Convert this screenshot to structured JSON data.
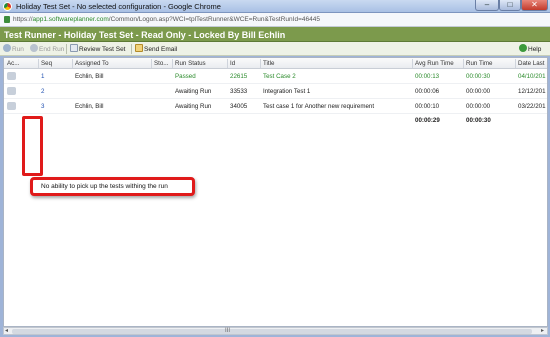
{
  "window": {
    "title": "Holiday Test Set - No selected configuration - Google Chrome",
    "min": "–",
    "max": "□",
    "close": "✕"
  },
  "address": {
    "scheme": "https://",
    "host": "app1.softwareplanner.com",
    "path": "/Common/Logon.asp?WCI=tplTestRunner&WCE=Run&TestRunId=46445"
  },
  "header": {
    "title": "Test Runner - Holiday Test Set - Read Only - Locked By Bill Echlin"
  },
  "toolbar": {
    "run": "Run",
    "end_run": "End Run",
    "review": "Review Test Set",
    "email": "Send Email",
    "help": "Help"
  },
  "columns": [
    "Ac...",
    "Seq",
    "Assigned To",
    "Sto...",
    "Run Status",
    "Id",
    "Title",
    "Avg Run Time",
    "Run Time",
    "Date Last"
  ],
  "rows": [
    {
      "seq": "1",
      "assigned": "Echlin, Bill",
      "status": "Passed",
      "id": "22615",
      "title": "Test Case 2",
      "avg": "00:00:13",
      "run": "00:00:30",
      "date": "04/10/201"
    },
    {
      "seq": "2",
      "assigned": "",
      "status": "Awaiting Run",
      "id": "33533",
      "title": "Integration Test 1",
      "avg": "00:00:06",
      "run": "00:00:00",
      "date": "12/12/201"
    },
    {
      "seq": "3",
      "assigned": "Echlin, Bill",
      "status": "Awaiting Run",
      "id": "34005",
      "title": "Test case 1 for Another new requirement",
      "avg": "00:00:10",
      "run": "00:00:00",
      "date": "03/22/201"
    }
  ],
  "totals": {
    "avg": "00:00:29",
    "run": "00:00:30"
  },
  "callout": {
    "text": "No ability to pick up the tests withing the run"
  },
  "scrollbar": {
    "left": "◂",
    "right": "▸",
    "grip": "III"
  },
  "colors": {
    "header_green": "#7c9a4c",
    "passed": "#2a8a2a",
    "highlight": "#e01a1a"
  }
}
